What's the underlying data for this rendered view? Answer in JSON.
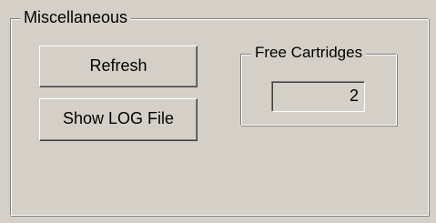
{
  "misc_group": {
    "title": "Miscellaneous",
    "refresh_label": "Refresh",
    "show_log_label": "Show LOG File"
  },
  "free_cartridges": {
    "title": "Free Cartridges",
    "value": "2"
  },
  "colors": {
    "face": "#d4d0c8",
    "highlight": "#ffffff",
    "shadow": "#808080",
    "dark_shadow": "#404040"
  }
}
